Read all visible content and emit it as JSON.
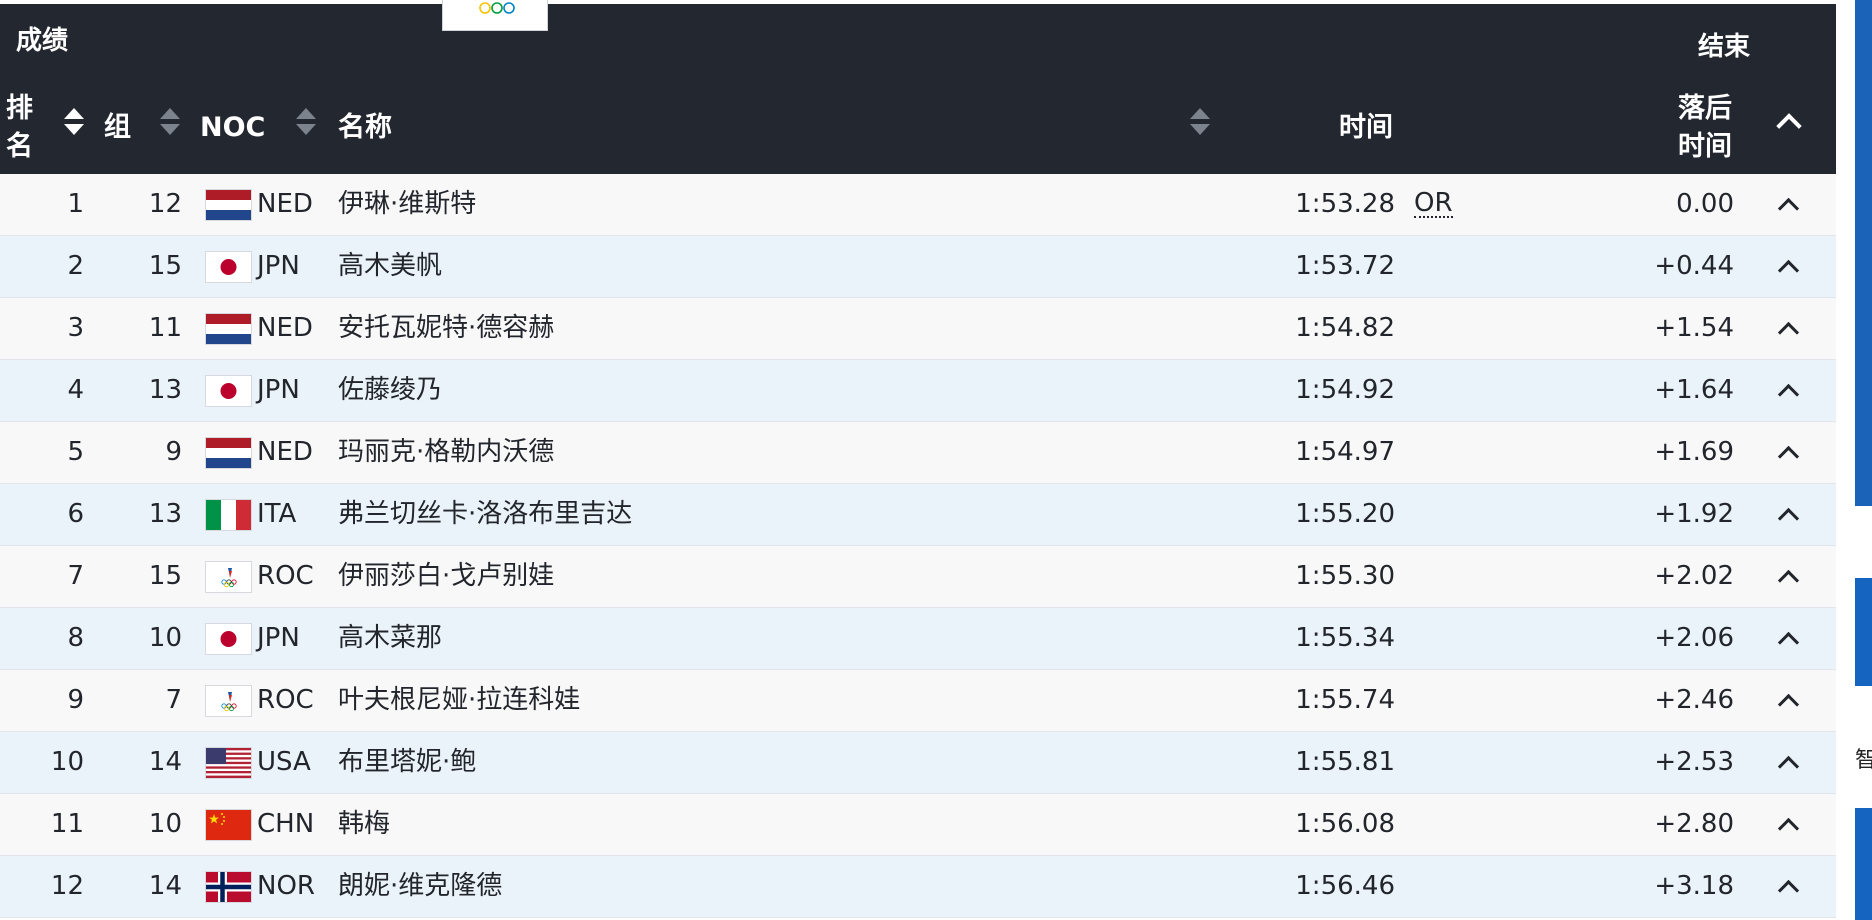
{
  "header": {
    "title": "成绩",
    "status": "结束",
    "columns": {
      "rank": "排名",
      "group": "组",
      "noc": "NOC",
      "name": "名称",
      "time": "时间",
      "behind_line1": "落后",
      "behind_line2": "时间"
    }
  },
  "rows": [
    {
      "rank": "1",
      "group": "12",
      "noc": "NED",
      "name": "伊琳·维斯特",
      "time": "1:53.28",
      "mark": "OR",
      "behind": "0.00"
    },
    {
      "rank": "2",
      "group": "15",
      "noc": "JPN",
      "name": "高木美帆",
      "time": "1:53.72",
      "mark": "",
      "behind": "+0.44"
    },
    {
      "rank": "3",
      "group": "11",
      "noc": "NED",
      "name": "安托瓦妮特·德容赫",
      "time": "1:54.82",
      "mark": "",
      "behind": "+1.54"
    },
    {
      "rank": "4",
      "group": "13",
      "noc": "JPN",
      "name": "佐藤绫乃",
      "time": "1:54.92",
      "mark": "",
      "behind": "+1.64"
    },
    {
      "rank": "5",
      "group": "9",
      "noc": "NED",
      "name": "玛丽克·格勒内沃德",
      "time": "1:54.97",
      "mark": "",
      "behind": "+1.69"
    },
    {
      "rank": "6",
      "group": "13",
      "noc": "ITA",
      "name": "弗兰切丝卡·洛洛布里吉达",
      "time": "1:55.20",
      "mark": "",
      "behind": "+1.92"
    },
    {
      "rank": "7",
      "group": "15",
      "noc": "ROC",
      "name": "伊丽莎白·戈卢别娃",
      "time": "1:55.30",
      "mark": "",
      "behind": "+2.02"
    },
    {
      "rank": "8",
      "group": "10",
      "noc": "JPN",
      "name": "高木菜那",
      "time": "1:55.34",
      "mark": "",
      "behind": "+2.06"
    },
    {
      "rank": "9",
      "group": "7",
      "noc": "ROC",
      "name": "叶夫根尼娅·拉连科娃",
      "time": "1:55.74",
      "mark": "",
      "behind": "+2.46"
    },
    {
      "rank": "10",
      "group": "14",
      "noc": "USA",
      "name": "布里塔妮·鲍",
      "time": "1:55.81",
      "mark": "",
      "behind": "+2.53"
    },
    {
      "rank": "11",
      "group": "10",
      "noc": "CHN",
      "name": "韩梅",
      "time": "1:56.08",
      "mark": "",
      "behind": "+2.80"
    },
    {
      "rank": "12",
      "group": "14",
      "noc": "NOR",
      "name": "朗妮·维克隆德",
      "time": "1:56.46",
      "mark": "",
      "behind": "+3.18"
    }
  ],
  "side_text": "智",
  "colors": {
    "header_bg": "#23272f",
    "row_odd": "#f8f8f8",
    "row_even": "#eaf3f9",
    "side_blue": "#1565c0"
  }
}
